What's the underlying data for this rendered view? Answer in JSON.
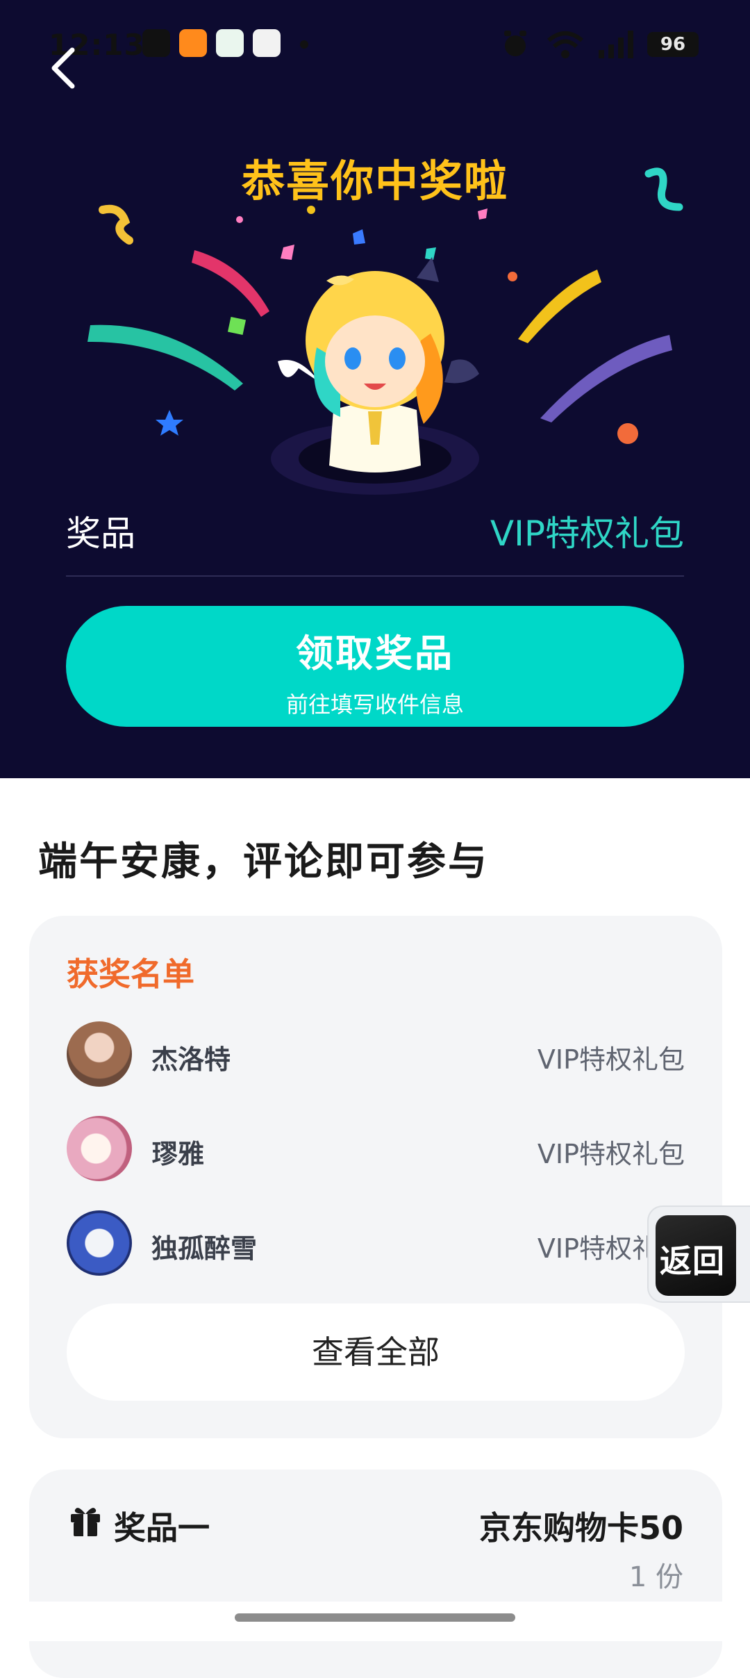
{
  "status_bar": {
    "time": "12:13",
    "battery": "96"
  },
  "hero": {
    "headline": "恭喜你中奖啦",
    "prize_label": "奖品",
    "prize_value": "VIP特权礼包",
    "claim_button": {
      "title": "领取奖品",
      "subtitle": "前往填写收件信息"
    }
  },
  "campaign": {
    "title": "端午安康，评论即可参与"
  },
  "winners": {
    "title": "获奖名单",
    "items": [
      {
        "name": "杰洛特",
        "prize": "VIP特权礼包"
      },
      {
        "name": "璆雅",
        "prize": "VIP特权礼包"
      },
      {
        "name": "独孤醉雪",
        "prize": "VIP特权礼包"
      }
    ],
    "view_all_label": "查看全部"
  },
  "float_return": {
    "label": "返回"
  },
  "prize_card": {
    "title": "奖品一",
    "name": "京东购物卡50",
    "quantity": "1 份"
  },
  "colors": {
    "hero_background": "#0d0b30",
    "headline": "#ffc21a",
    "accent_teal": "#00d8c8",
    "prize_value": "#2fd6c6",
    "winners_title": "#f06a2b",
    "card_background": "#f4f5f7"
  },
  "icons": [
    "back-arrow-icon",
    "gift-icon",
    "wifi-icon",
    "signal-icon",
    "alarm-icon"
  ]
}
